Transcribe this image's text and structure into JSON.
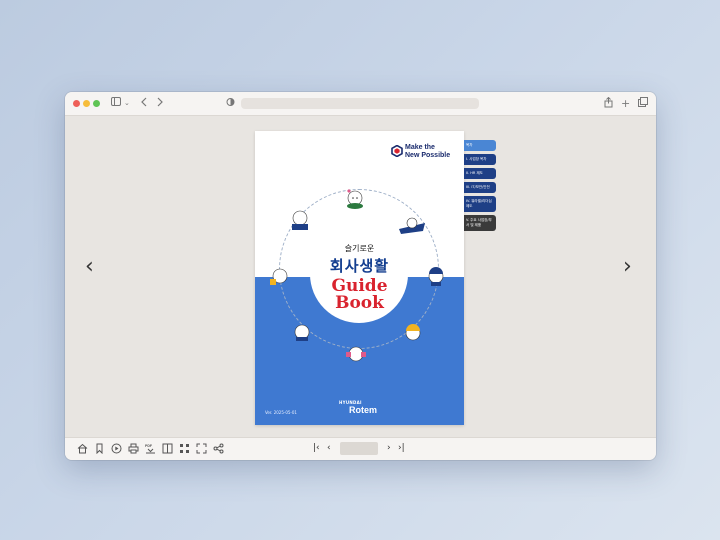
{
  "toolbar": {
    "address": "",
    "icons": [
      "sidebar-icon",
      "chevron-down-icon",
      "back-icon",
      "forward-icon",
      "privacy-icon",
      "share-icon",
      "new-tab-icon",
      "tabs-icon"
    ]
  },
  "viewer": {
    "prev_glyph": "‹",
    "next_glyph": "›"
  },
  "cover": {
    "brand": "Make the\nNew Possible",
    "subtitle": "슬기로운",
    "title": "회사생활",
    "guide": "Guide",
    "book": "Book",
    "version": "Ver. 2025-05-01",
    "logo_top": "HYUNDAI",
    "logo_main": "Rotem",
    "colors": {
      "blue": "#3f79d1",
      "navy": "#123d8f",
      "red": "#d9232e"
    }
  },
  "toc": {
    "items": [
      "목차",
      "I. 사업장 목차",
      "II. HR 제도",
      "III. IT/보안/안전",
      "IV. 워라밸/리더십 제도",
      "V. 주요 사업장/부서 및 제품"
    ]
  },
  "bottom": {
    "tools": [
      "home-icon",
      "bookmark-icon",
      "play-icon",
      "print-icon",
      "pdf-download-icon",
      "page-layout-icon",
      "thumbnails-icon",
      "fullscreen-icon",
      "share-icon"
    ],
    "first": "|‹",
    "prev": "‹",
    "page": "",
    "next": "›",
    "last": "›|"
  }
}
